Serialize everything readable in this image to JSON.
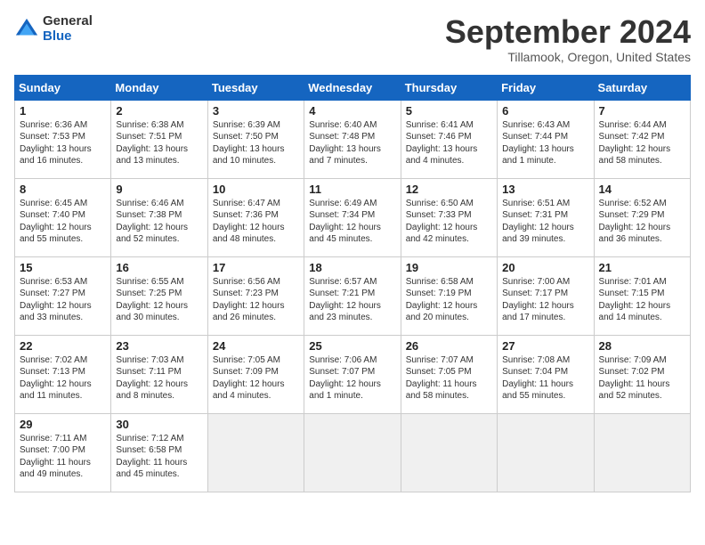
{
  "header": {
    "logo_general": "General",
    "logo_blue": "Blue",
    "title": "September 2024",
    "location": "Tillamook, Oregon, United States"
  },
  "weekdays": [
    "Sunday",
    "Monday",
    "Tuesday",
    "Wednesday",
    "Thursday",
    "Friday",
    "Saturday"
  ],
  "weeks": [
    [
      {
        "num": "1",
        "info": "Sunrise: 6:36 AM\nSunset: 7:53 PM\nDaylight: 13 hours\nand 16 minutes."
      },
      {
        "num": "2",
        "info": "Sunrise: 6:38 AM\nSunset: 7:51 PM\nDaylight: 13 hours\nand 13 minutes."
      },
      {
        "num": "3",
        "info": "Sunrise: 6:39 AM\nSunset: 7:50 PM\nDaylight: 13 hours\nand 10 minutes."
      },
      {
        "num": "4",
        "info": "Sunrise: 6:40 AM\nSunset: 7:48 PM\nDaylight: 13 hours\nand 7 minutes."
      },
      {
        "num": "5",
        "info": "Sunrise: 6:41 AM\nSunset: 7:46 PM\nDaylight: 13 hours\nand 4 minutes."
      },
      {
        "num": "6",
        "info": "Sunrise: 6:43 AM\nSunset: 7:44 PM\nDaylight: 13 hours\nand 1 minute."
      },
      {
        "num": "7",
        "info": "Sunrise: 6:44 AM\nSunset: 7:42 PM\nDaylight: 12 hours\nand 58 minutes."
      }
    ],
    [
      {
        "num": "8",
        "info": "Sunrise: 6:45 AM\nSunset: 7:40 PM\nDaylight: 12 hours\nand 55 minutes."
      },
      {
        "num": "9",
        "info": "Sunrise: 6:46 AM\nSunset: 7:38 PM\nDaylight: 12 hours\nand 52 minutes."
      },
      {
        "num": "10",
        "info": "Sunrise: 6:47 AM\nSunset: 7:36 PM\nDaylight: 12 hours\nand 48 minutes."
      },
      {
        "num": "11",
        "info": "Sunrise: 6:49 AM\nSunset: 7:34 PM\nDaylight: 12 hours\nand 45 minutes."
      },
      {
        "num": "12",
        "info": "Sunrise: 6:50 AM\nSunset: 7:33 PM\nDaylight: 12 hours\nand 42 minutes."
      },
      {
        "num": "13",
        "info": "Sunrise: 6:51 AM\nSunset: 7:31 PM\nDaylight: 12 hours\nand 39 minutes."
      },
      {
        "num": "14",
        "info": "Sunrise: 6:52 AM\nSunset: 7:29 PM\nDaylight: 12 hours\nand 36 minutes."
      }
    ],
    [
      {
        "num": "15",
        "info": "Sunrise: 6:53 AM\nSunset: 7:27 PM\nDaylight: 12 hours\nand 33 minutes."
      },
      {
        "num": "16",
        "info": "Sunrise: 6:55 AM\nSunset: 7:25 PM\nDaylight: 12 hours\nand 30 minutes."
      },
      {
        "num": "17",
        "info": "Sunrise: 6:56 AM\nSunset: 7:23 PM\nDaylight: 12 hours\nand 26 minutes."
      },
      {
        "num": "18",
        "info": "Sunrise: 6:57 AM\nSunset: 7:21 PM\nDaylight: 12 hours\nand 23 minutes."
      },
      {
        "num": "19",
        "info": "Sunrise: 6:58 AM\nSunset: 7:19 PM\nDaylight: 12 hours\nand 20 minutes."
      },
      {
        "num": "20",
        "info": "Sunrise: 7:00 AM\nSunset: 7:17 PM\nDaylight: 12 hours\nand 17 minutes."
      },
      {
        "num": "21",
        "info": "Sunrise: 7:01 AM\nSunset: 7:15 PM\nDaylight: 12 hours\nand 14 minutes."
      }
    ],
    [
      {
        "num": "22",
        "info": "Sunrise: 7:02 AM\nSunset: 7:13 PM\nDaylight: 12 hours\nand 11 minutes."
      },
      {
        "num": "23",
        "info": "Sunrise: 7:03 AM\nSunset: 7:11 PM\nDaylight: 12 hours\nand 8 minutes."
      },
      {
        "num": "24",
        "info": "Sunrise: 7:05 AM\nSunset: 7:09 PM\nDaylight: 12 hours\nand 4 minutes."
      },
      {
        "num": "25",
        "info": "Sunrise: 7:06 AM\nSunset: 7:07 PM\nDaylight: 12 hours\nand 1 minute."
      },
      {
        "num": "26",
        "info": "Sunrise: 7:07 AM\nSunset: 7:05 PM\nDaylight: 11 hours\nand 58 minutes."
      },
      {
        "num": "27",
        "info": "Sunrise: 7:08 AM\nSunset: 7:04 PM\nDaylight: 11 hours\nand 55 minutes."
      },
      {
        "num": "28",
        "info": "Sunrise: 7:09 AM\nSunset: 7:02 PM\nDaylight: 11 hours\nand 52 minutes."
      }
    ],
    [
      {
        "num": "29",
        "info": "Sunrise: 7:11 AM\nSunset: 7:00 PM\nDaylight: 11 hours\nand 49 minutes."
      },
      {
        "num": "30",
        "info": "Sunrise: 7:12 AM\nSunset: 6:58 PM\nDaylight: 11 hours\nand 45 minutes."
      },
      {
        "num": "",
        "info": ""
      },
      {
        "num": "",
        "info": ""
      },
      {
        "num": "",
        "info": ""
      },
      {
        "num": "",
        "info": ""
      },
      {
        "num": "",
        "info": ""
      }
    ]
  ]
}
